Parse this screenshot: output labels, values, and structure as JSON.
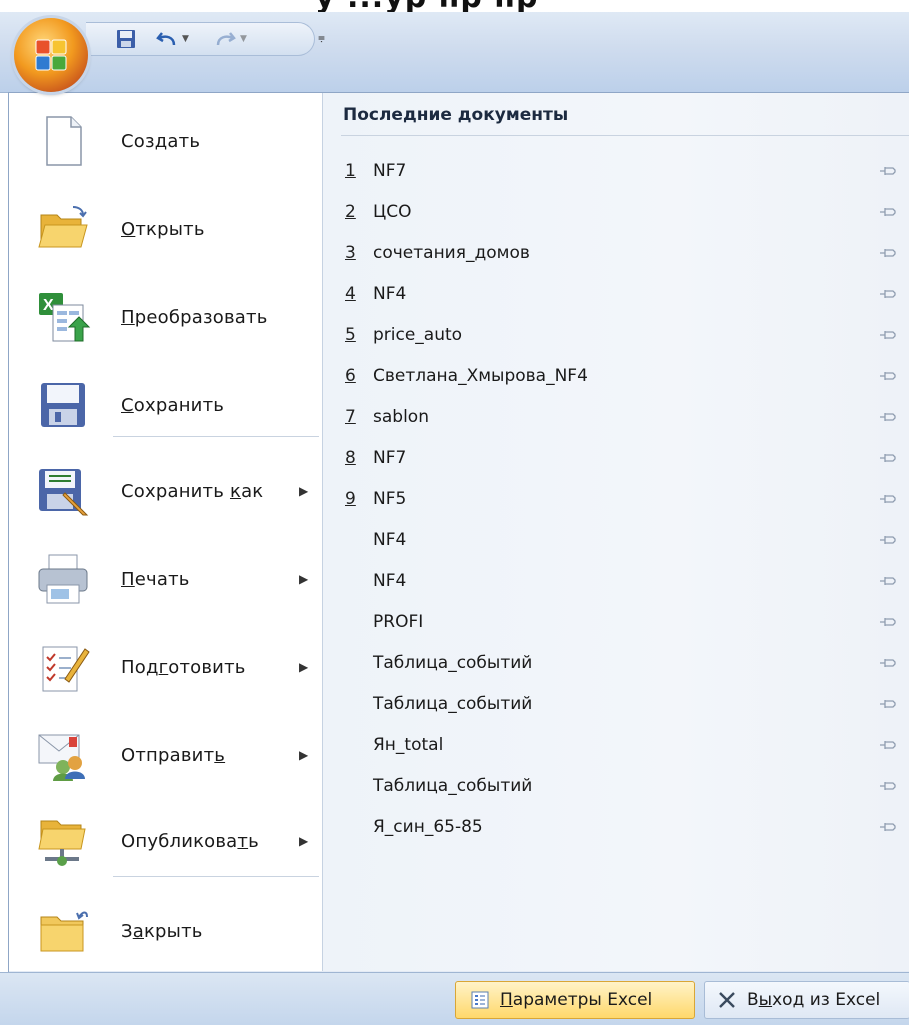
{
  "header_fragment": "у  ...ур  пр  пр",
  "qat": {
    "save_tooltip_icon": "save-icon",
    "undo_icon": "undo-icon",
    "redo_icon": "redo-icon",
    "customize_glyph": "⩦"
  },
  "left_menu": {
    "items": [
      {
        "id": "new",
        "pre": "Соз",
        "u": "д",
        "post": "ать",
        "submenu": false,
        "icon": "new-document-icon"
      },
      {
        "id": "open",
        "pre": "",
        "u": "О",
        "post": "ткрыть",
        "submenu": false,
        "icon": "open-folder-icon"
      },
      {
        "id": "convert",
        "pre": "",
        "u": "П",
        "post": "реобразовать",
        "submenu": false,
        "icon": "convert-icon"
      },
      {
        "id": "save",
        "pre": "",
        "u": "С",
        "post": "охранить",
        "submenu": false,
        "icon": "save-icon"
      },
      {
        "id": "saveas",
        "pre": "Сохранить ",
        "u": "к",
        "post": "ак",
        "submenu": true,
        "icon": "save-as-icon"
      },
      {
        "id": "print",
        "pre": "",
        "u": "П",
        "post": "ечать",
        "submenu": true,
        "icon": "printer-icon"
      },
      {
        "id": "prepare",
        "pre": "Под",
        "u": "г",
        "post": "отовить",
        "submenu": true,
        "icon": "prepare-icon"
      },
      {
        "id": "send",
        "pre": "Отправит",
        "u": "ь",
        "post": "",
        "submenu": true,
        "icon": "send-icon"
      },
      {
        "id": "publish",
        "pre": "Опубликова",
        "u": "т",
        "post": "ь",
        "submenu": true,
        "icon": "publish-icon"
      },
      {
        "id": "close",
        "pre": "З",
        "u": "а",
        "post": "крыть",
        "submenu": false,
        "icon": "close-folder-icon"
      }
    ]
  },
  "recent": {
    "title": "Последние документы",
    "docs": [
      {
        "num": "1",
        "name": "NF7"
      },
      {
        "num": "2",
        "name": "ЦСО"
      },
      {
        "num": "3",
        "name": "сочетания_домов"
      },
      {
        "num": "4",
        "name": "NF4"
      },
      {
        "num": "5",
        "name": "price_auto"
      },
      {
        "num": "6",
        "name": "Светлана_Хмырова_NF4"
      },
      {
        "num": "7",
        "name": "sablon"
      },
      {
        "num": "8",
        "name": "NF7"
      },
      {
        "num": "9",
        "name": "NF5"
      },
      {
        "num": "",
        "name": "NF4"
      },
      {
        "num": "",
        "name": "NF4"
      },
      {
        "num": "",
        "name": "PROFI"
      },
      {
        "num": "",
        "name": "Таблица_событий"
      },
      {
        "num": "",
        "name": "Таблица_событий"
      },
      {
        "num": "",
        "name": "Ян_total"
      },
      {
        "num": "",
        "name": "Таблица_событий"
      },
      {
        "num": "",
        "name": "Я_син_65-85"
      }
    ]
  },
  "bottom": {
    "options": {
      "pre": "",
      "u": "П",
      "post": "араметры Excel"
    },
    "exit": {
      "pre": "В",
      "u": "ы",
      "post": "ход из Excel"
    }
  }
}
